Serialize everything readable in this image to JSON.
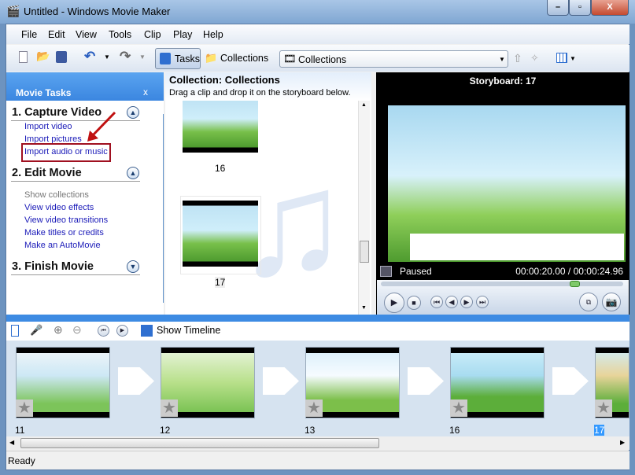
{
  "window": {
    "title": "Untitled - Windows Movie Maker",
    "minimize": "–",
    "maximize": "▫",
    "close": "X"
  },
  "menu": [
    "File",
    "Edit",
    "View",
    "Tools",
    "Clip",
    "Play",
    "Help"
  ],
  "toolbar": {
    "tasks": "Tasks",
    "collections": "Collections",
    "combo_value": "Collections"
  },
  "tasks": {
    "header": "Movie Tasks",
    "close": "x",
    "sections": [
      {
        "title": "1. Capture Video",
        "links": [
          "Import video",
          "Import pictures",
          "Import audio or music"
        ]
      },
      {
        "title": "2. Edit Movie",
        "links": [
          "Show collections",
          "View video effects",
          "View video transitions",
          "Make titles or credits",
          "Make an AutoMovie"
        ]
      },
      {
        "title": "3. Finish Movie",
        "links": []
      }
    ]
  },
  "collection": {
    "title": "Collection: Collections",
    "subtitle": "Drag a clip and drop it on the storyboard below.",
    "items": [
      "16",
      "17"
    ]
  },
  "preview": {
    "title": "Storyboard: 17",
    "status": "Paused",
    "time": "00:00:20.00 / 00:00:24.96",
    "progress_fraction": 0.8
  },
  "storyboard": {
    "show_timeline": "Show Timeline",
    "clips": [
      "11",
      "12",
      "13",
      "16",
      "17"
    ],
    "selected": "17"
  },
  "statusbar": {
    "text": "Ready"
  },
  "colors": {
    "accent": "#3d8be3",
    "link": "#1a1ab8",
    "highlight_box": "#a01020"
  }
}
